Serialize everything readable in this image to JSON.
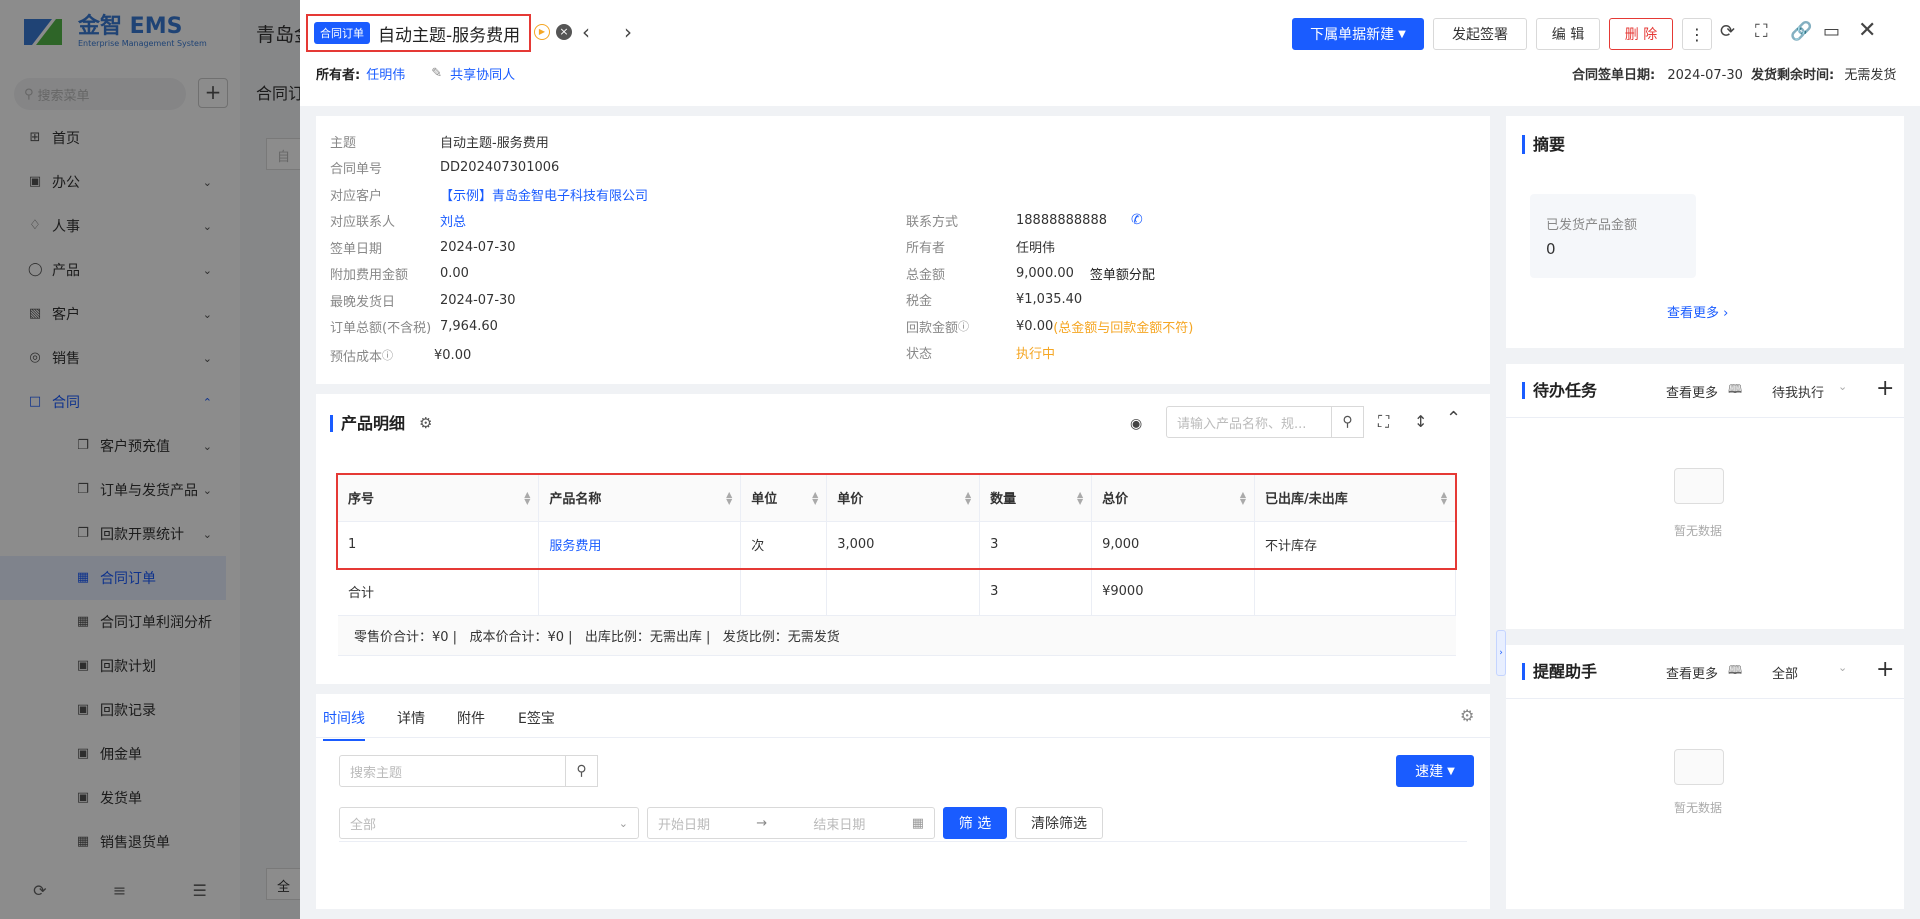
{
  "sidebar": {
    "logo_title": "金智 EMS",
    "logo_subtitle": "Enterprise Management System",
    "search_placeholder": "搜索菜单",
    "items": [
      {
        "label": "首页",
        "icon": "home-icon"
      },
      {
        "label": "办公",
        "icon": "office-icon"
      },
      {
        "label": "人事",
        "icon": "people-icon"
      },
      {
        "label": "产品",
        "icon": "product-icon"
      },
      {
        "label": "客户",
        "icon": "customer-icon"
      },
      {
        "label": "销售",
        "icon": "sales-icon"
      },
      {
        "label": "合同",
        "icon": "contract-icon"
      }
    ],
    "sub_items": [
      {
        "label": "客户预充值"
      },
      {
        "label": "订单与发货产品"
      },
      {
        "label": "回款开票统计"
      },
      {
        "label": "合同订单"
      },
      {
        "label": "合同订单利润分析"
      },
      {
        "label": "回款计划"
      },
      {
        "label": "回款记录"
      },
      {
        "label": "佣金单"
      },
      {
        "label": "发货单"
      },
      {
        "label": "销售退货单"
      }
    ]
  },
  "background": {
    "title": "青岛金",
    "subtitle": "合同订",
    "input_text": "自",
    "bottom_text": "全"
  },
  "header": {
    "badge": "合同订单",
    "title": "自动主题-服务费用",
    "owner_label": "所有者:",
    "owner_name": "任明伟",
    "share_label": "共享协同人",
    "sign_date_label": "合同签单日期:",
    "sign_date": "2024-07-30",
    "ship_remaining_label": "发货剩余时间:",
    "ship_remaining": "无需发货",
    "buttons": {
      "new_sub": "下属单据新建",
      "sign": "发起签署",
      "edit": "编 辑",
      "delete": "删 除"
    }
  },
  "info": {
    "left": [
      {
        "label": "主题",
        "value": "自动主题-服务费用"
      },
      {
        "label": "合同单号",
        "value": "DD202407301006"
      },
      {
        "label": "对应客户",
        "value": "【示例】青岛金智电子科技有限公司"
      },
      {
        "label": "对应联系人",
        "value": "刘总"
      },
      {
        "label": "签单日期",
        "value": "2024-07-30"
      },
      {
        "label": "附加费用金额",
        "value": "0.00"
      },
      {
        "label": "最晚发货日",
        "value": "2024-07-30"
      },
      {
        "label": "订单总额(不含税)",
        "value": "7,964.60"
      },
      {
        "label": "预估成本",
        "value": "¥0.00"
      }
    ],
    "right": [
      {
        "label": "联系方式",
        "value": "18888888888"
      },
      {
        "label": "所有者",
        "value": "任明伟"
      },
      {
        "label": "总金额",
        "value": "9,000.00",
        "extra": "签单额分配"
      },
      {
        "label": "税金",
        "value": "¥1,035.40"
      },
      {
        "label": "回款金额",
        "value": "¥0.00",
        "extra": "(总金额与回款金额不符)"
      },
      {
        "label": "状态",
        "value": "执行中"
      }
    ]
  },
  "products": {
    "title": "产品明细",
    "search_placeholder": "请输入产品名称、规...",
    "columns": [
      "序号",
      "产品名称",
      "单位",
      "单价",
      "数量",
      "总价",
      "已出库/未出库"
    ],
    "rows": [
      [
        "1",
        "服务费用",
        "次",
        "3,000",
        "3",
        "9,000",
        "不计库存"
      ]
    ],
    "total_row": [
      "合计",
      "",
      "",
      "",
      "3",
      "¥9000",
      ""
    ],
    "summary": "零售价合计：¥0 |   成本价合计：¥0 |   出库比例：无需出库 |   发货比例：无需发货"
  },
  "timeline": {
    "tabs": [
      "时间线",
      "详情",
      "附件",
      "E签宝"
    ],
    "search_placeholder": "搜索主题",
    "quick_new": "速建",
    "filter_all": "全部",
    "start_date": "开始日期",
    "end_date": "结束日期",
    "filter_btn": "筛 选",
    "clear_btn": "清除筛选"
  },
  "right_panel": {
    "summary_title": "摘要",
    "shipped_label": "已发货产品金额",
    "shipped_value": "0",
    "see_more": "查看更多",
    "todo_title": "待办任务",
    "todo_filter": "待我执行",
    "empty": "暂无数据",
    "reminder_title": "提醒助手",
    "reminder_filter": "全部"
  },
  "colors": {
    "primary": "#1a5cff",
    "danger": "#e53935",
    "warning": "#f5a623",
    "highlight_border": "#e53935"
  }
}
